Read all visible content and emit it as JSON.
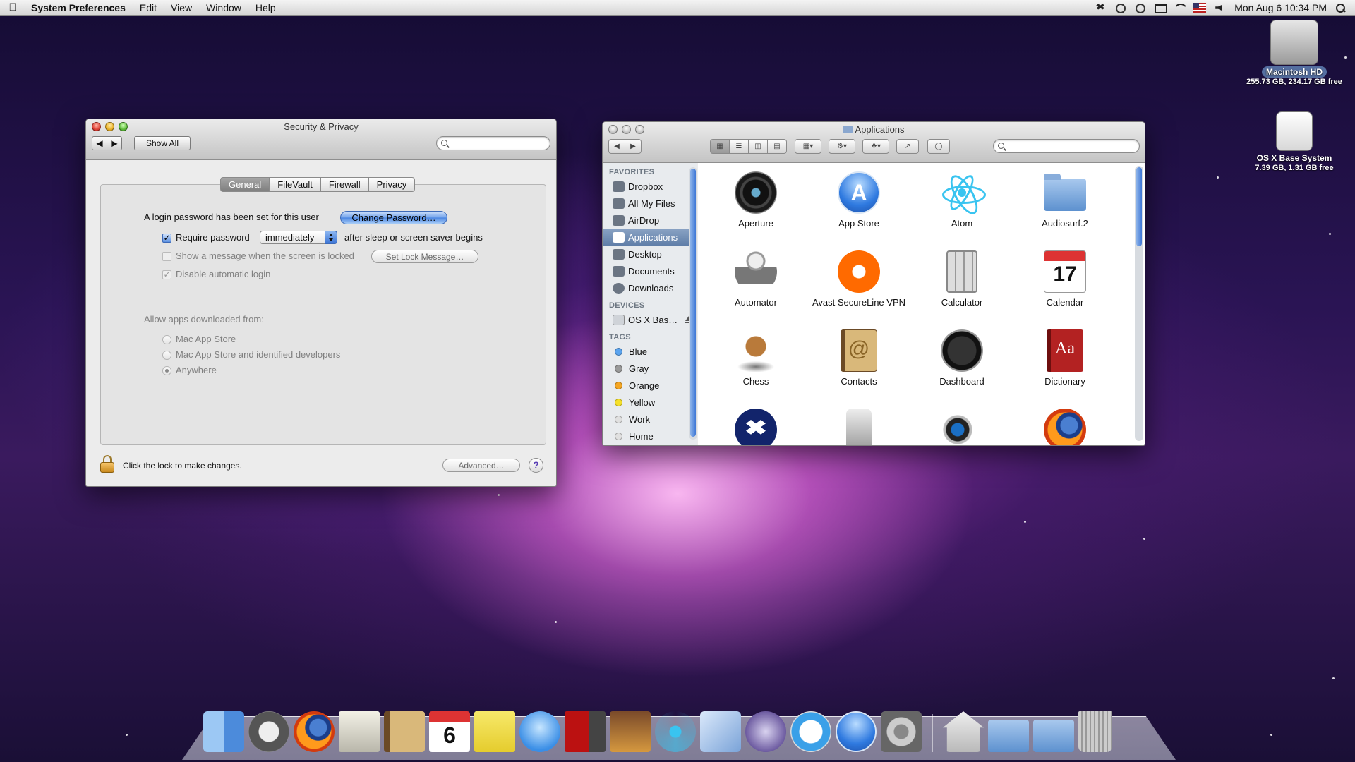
{
  "menubar": {
    "app_name": "System Preferences",
    "menus": [
      "Edit",
      "View",
      "Window",
      "Help"
    ],
    "clock": "Mon Aug 6  10:34 PM",
    "status_icons": [
      "dropbox-icon",
      "wireless-signal-icon",
      "time-machine-icon",
      "airplay-display-icon",
      "wifi-icon",
      "us-flag-input-icon",
      "volume-icon",
      "spotlight-icon"
    ]
  },
  "desktop": {
    "drives": [
      {
        "name": "Macintosh HD",
        "info": "255.73 GB, 234.17 GB free"
      },
      {
        "name": "OS X Base System",
        "info": "7.39 GB, 1.31 GB free"
      }
    ]
  },
  "security_window": {
    "title": "Security & Privacy",
    "show_all": "Show All",
    "search_placeholder": "",
    "tabs": [
      "General",
      "FileVault",
      "Firewall",
      "Privacy"
    ],
    "active_tab": "General",
    "login_text": "A login password has been set for this user",
    "change_password": "Change Password…",
    "require_password": "Require password",
    "require_value": "immediately",
    "after_sleep": "after sleep or screen saver begins",
    "show_message": "Show a message when the screen is locked",
    "set_lock_message": "Set Lock Message…",
    "disable_auto_login": "Disable automatic login",
    "allow_apps_label": "Allow apps downloaded from:",
    "radio_options": [
      "Mac App Store",
      "Mac App Store and identified developers",
      "Anywhere"
    ],
    "selected_option": "Anywhere",
    "lock_text": "Click the lock to make changes.",
    "advanced": "Advanced…",
    "help": "?"
  },
  "finder_window": {
    "title": "Applications",
    "search_placeholder": "",
    "sidebar": {
      "favorites_header": "FAVORITES",
      "favorites": [
        {
          "label": "Dropbox",
          "icon": "dropbox-icon"
        },
        {
          "label": "All My Files",
          "icon": "all-my-files-icon"
        },
        {
          "label": "AirDrop",
          "icon": "airdrop-icon"
        },
        {
          "label": "Applications",
          "icon": "applications-icon"
        },
        {
          "label": "Desktop",
          "icon": "desktop-icon"
        },
        {
          "label": "Documents",
          "icon": "documents-icon"
        },
        {
          "label": "Downloads",
          "icon": "downloads-icon"
        }
      ],
      "active_item": "Applications",
      "devices_header": "DEVICES",
      "devices": [
        {
          "label": "OS X Bas…",
          "icon": "disk-icon"
        }
      ],
      "tags_header": "TAGS",
      "tags": [
        {
          "label": "Blue",
          "color": "#5ba4ef"
        },
        {
          "label": "Gray",
          "color": "#9a9a9a"
        },
        {
          "label": "Orange",
          "color": "#f5a623"
        },
        {
          "label": "Yellow",
          "color": "#f5e02a"
        },
        {
          "label": "Work",
          "color": "#e0e0e0"
        },
        {
          "label": "Home",
          "color": "#e0e0e0"
        }
      ]
    },
    "apps": [
      {
        "label": "Aperture",
        "icon": "aperture-icon"
      },
      {
        "label": "App Store",
        "icon": "app-store-icon"
      },
      {
        "label": "Atom",
        "icon": "atom-icon"
      },
      {
        "label": "Audiosurf.2",
        "icon": "folder-icon"
      },
      {
        "label": "Automator",
        "icon": "automator-icon"
      },
      {
        "label": "Avast SecureLine VPN",
        "icon": "avast-icon"
      },
      {
        "label": "Calculator",
        "icon": "calculator-icon"
      },
      {
        "label": "Calendar",
        "icon": "calendar-icon"
      },
      {
        "label": "Chess",
        "icon": "chess-icon"
      },
      {
        "label": "Contacts",
        "icon": "contacts-icon"
      },
      {
        "label": "Dashboard",
        "icon": "dashboard-icon"
      },
      {
        "label": "Dictionary",
        "icon": "dictionary-icon"
      },
      {
        "label": "",
        "icon": "dropbox-icon"
      },
      {
        "label": "",
        "icon": "dvd-player-icon"
      },
      {
        "label": "",
        "icon": "facetime-icon"
      },
      {
        "label": "",
        "icon": "firefox-icon"
      }
    ]
  },
  "dock": {
    "calendar_day": "6",
    "items": [
      "finder-icon",
      "launchpad-icon",
      "firefox-icon",
      "mail-icon",
      "contacts-icon",
      "calendar-icon",
      "notes-icon",
      "messages-icon",
      "photo-booth-icon",
      "iphoto-icon",
      "atom-icon",
      "cube-app-icon",
      "script-editor-icon",
      "itunes-icon",
      "app-store-icon",
      "system-preferences-icon"
    ],
    "right_items": [
      "home-folder-icon",
      "applications-folder-icon",
      "downloads-folder-icon",
      "trash-icon"
    ]
  }
}
